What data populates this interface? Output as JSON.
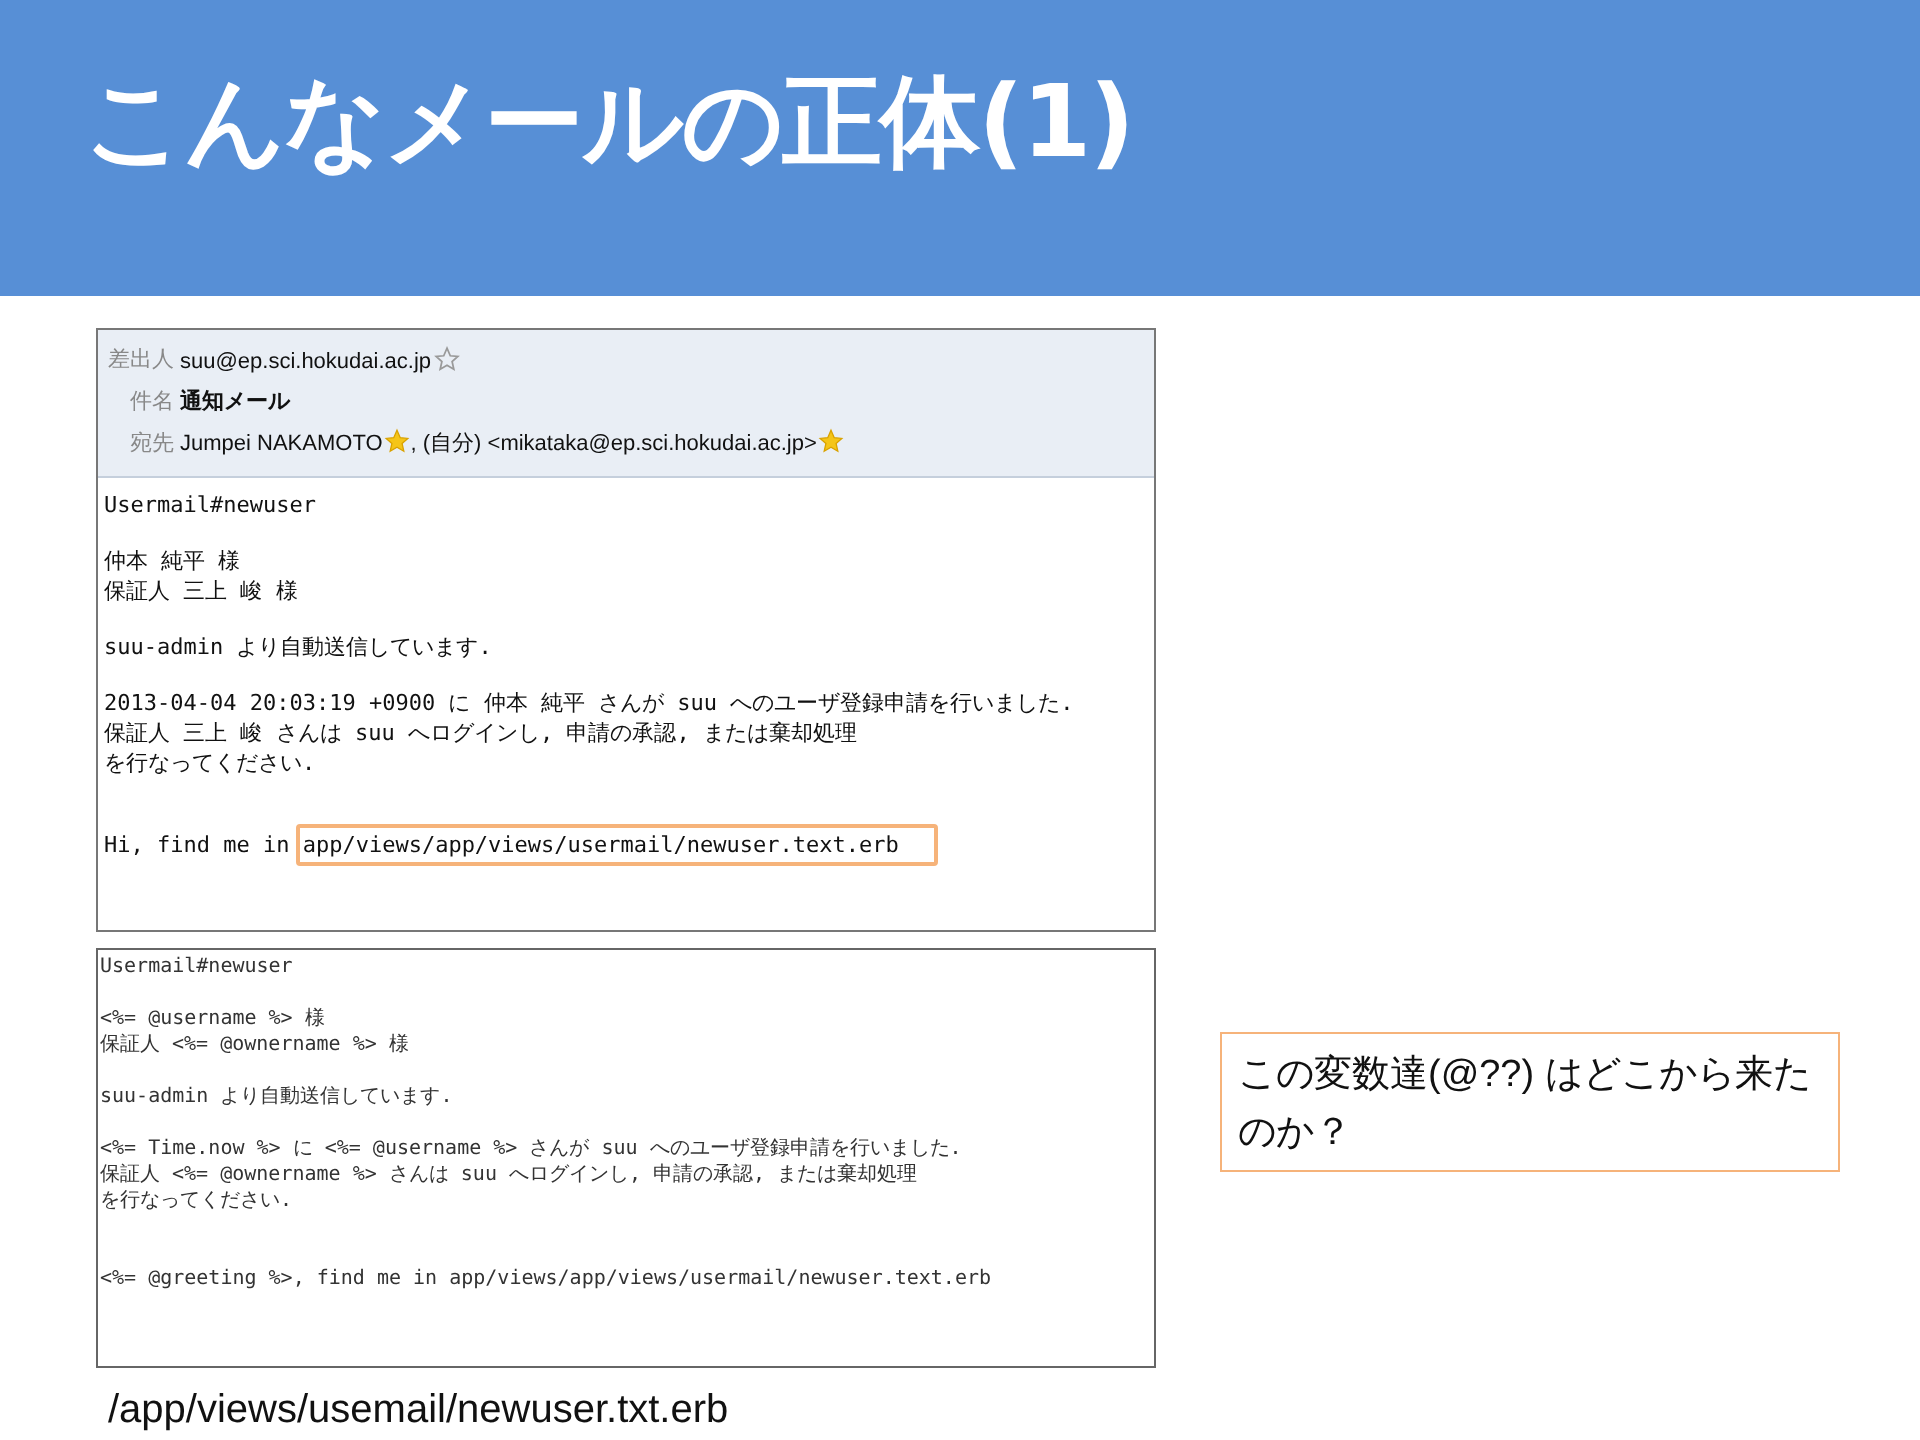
{
  "slide": {
    "title": "こんなメールの正体(1)"
  },
  "email": {
    "header_fields": [
      {
        "kind": "address",
        "label": "差出人",
        "parts": [
          {
            "text": "suu@ep.sci.hokudai.ac.jp",
            "starred": false
          }
        ]
      },
      {
        "kind": "subject",
        "label": "件名",
        "parts": [
          {
            "text": "通知メール"
          }
        ]
      },
      {
        "kind": "address",
        "label": "宛先",
        "parts": [
          {
            "text": "Jumpei NAKAMOTO",
            "starred": true
          },
          {
            "text": ", (自分) <mikataka@ep.sci.hokudai.ac.jp>",
            "starred": true
          }
        ]
      }
    ],
    "body": [
      {
        "lines": [
          "Usermail#newuser"
        ]
      },
      {
        "lines": [
          "仲本 純平 様",
          "保証人 三上 峻 様"
        ]
      },
      {
        "lines": [
          "suu-admin より自動送信しています."
        ]
      },
      {
        "lines": [
          "2013-04-04 20:03:19 +0900 に 仲本 純平 さんが suu へのユーザ登録申請を行いました.",
          "保証人 三上 峻 さんは suu へログインし, 申請の承認, または棄却処理",
          "を行なってください."
        ]
      },
      {
        "lines": [
          "Hi, find me in"
        ],
        "highlight": "app/views/app/views/usermail/newuser.text.erb"
      }
    ]
  },
  "template": {
    "body": [
      {
        "lines": [
          "Usermail#newuser"
        ]
      },
      {
        "lines": [
          "<%= @username %> 様",
          "保証人 <%= @ownername %> 様"
        ]
      },
      {
        "lines": [
          "suu-admin より自動送信しています."
        ]
      },
      {
        "lines": [
          "<%= Time.now %> に <%= @username %> さんが suu へのユーザ登録申請を行いました.",
          "保証人 <%= @ownername %> さんは suu へログインし, 申請の承認, または棄却処理",
          "を行なってください."
        ]
      },
      {
        "lines": [
          "<%= @greeting %>, find me in app/views/app/views/usermail/newuser.text.erb"
        ]
      }
    ]
  },
  "callout": {
    "text": "この変数達(@??) はどこから来たのか？"
  },
  "caption": "/app/views/usemail/newuser.txt.erb"
}
